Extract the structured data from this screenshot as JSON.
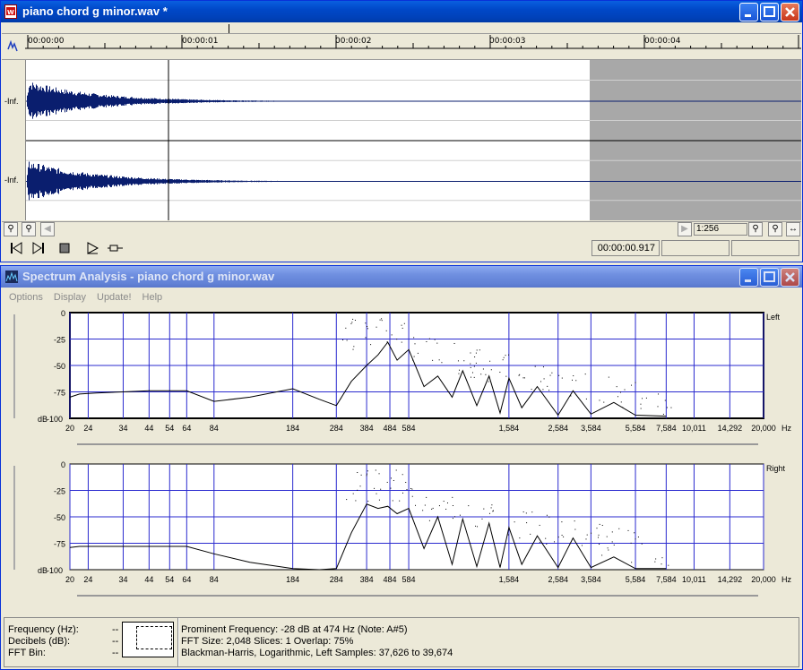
{
  "editor": {
    "title": "piano chord g minor.wav *",
    "app_icon": "wave-file-icon",
    "ruler": [
      "00:00:00",
      "00:00:01",
      "00:00:02",
      "00:00:03",
      "00:00:04"
    ],
    "channel_labels": [
      "-Inf.",
      "-Inf."
    ],
    "zoom_value": "1:256",
    "time_readout": "00:00:00.917",
    "colors": {
      "wave": "#0a1e6e",
      "selection": "#a8a8a8",
      "background": "#ffffff"
    }
  },
  "spectrum": {
    "title": "Spectrum Analysis - piano chord g minor.wav",
    "menu": [
      "Options",
      "Display",
      "Update!",
      "Help"
    ],
    "info": {
      "labels": [
        "Frequency (Hz):",
        "Decibels (dB):",
        "FFT Bin:"
      ],
      "values": [
        "--",
        "--",
        "--"
      ],
      "lines": [
        "Prominent Frequency: -28 dB at 474 Hz (Note: A#5)",
        "FFT Size: 2,048  Slices: 1  Overlap: 75%",
        "Blackman-Harris, Logarithmic, Left  Samples: 37,626 to 39,674"
      ]
    }
  },
  "chart_data": [
    {
      "type": "line",
      "legend": "Left",
      "ylabel": "dB",
      "ylim": [
        -100,
        0
      ],
      "yticks": [
        "0",
        "-25",
        "-50",
        "-75",
        "-100"
      ],
      "xticks": [
        "20",
        "24",
        "34",
        "44",
        "54",
        "64",
        "84",
        "184",
        "284",
        "384",
        "484",
        "584",
        "1,584",
        "2,584",
        "3,584",
        "5,584",
        "7,584",
        "10,011",
        "14,292",
        "20,000"
      ],
      "x_unit": "Hz",
      "x_scale": "log",
      "x": [
        20,
        22,
        26,
        34,
        44,
        54,
        64,
        84,
        120,
        184,
        240,
        284,
        330,
        384,
        430,
        474,
        520,
        584,
        680,
        780,
        900,
        1000,
        1150,
        1300,
        1450,
        1584,
        1800,
        2100,
        2584,
        3000,
        3584,
        4500,
        5584,
        7584
      ],
      "values": [
        -80,
        -77,
        -76,
        -75,
        -74,
        -74,
        -74,
        -84,
        -80,
        -72,
        -82,
        -88,
        -65,
        -50,
        -40,
        -28,
        -45,
        -35,
        -70,
        -60,
        -80,
        -55,
        -88,
        -60,
        -95,
        -62,
        -90,
        -70,
        -97,
        -74,
        -96,
        -85,
        -97,
        -98
      ]
    },
    {
      "type": "line",
      "legend": "Right",
      "ylabel": "dB",
      "ylim": [
        -100,
        0
      ],
      "yticks": [
        "0",
        "-25",
        "-50",
        "-75",
        "-100"
      ],
      "xticks": [
        "20",
        "24",
        "34",
        "44",
        "54",
        "64",
        "84",
        "184",
        "284",
        "384",
        "484",
        "584",
        "1,584",
        "2,584",
        "3,584",
        "5,584",
        "7,584",
        "10,011",
        "14,292",
        "20,000"
      ],
      "x_unit": "Hz",
      "x_scale": "log",
      "x": [
        20,
        22,
        26,
        34,
        44,
        54,
        64,
        84,
        120,
        184,
        240,
        284,
        330,
        384,
        430,
        474,
        520,
        584,
        680,
        780,
        900,
        1000,
        1150,
        1300,
        1450,
        1584,
        1800,
        2100,
        2584,
        3000,
        3584,
        4500,
        5584,
        7584
      ],
      "values": [
        -79,
        -78,
        -78,
        -78,
        -78,
        -78,
        -78,
        -85,
        -93,
        -99,
        -101,
        -99,
        -65,
        -38,
        -42,
        -40,
        -47,
        -42,
        -80,
        -50,
        -95,
        -52,
        -97,
        -56,
        -98,
        -60,
        -95,
        -68,
        -98,
        -70,
        -98,
        -88,
        -99,
        -99
      ]
    }
  ]
}
